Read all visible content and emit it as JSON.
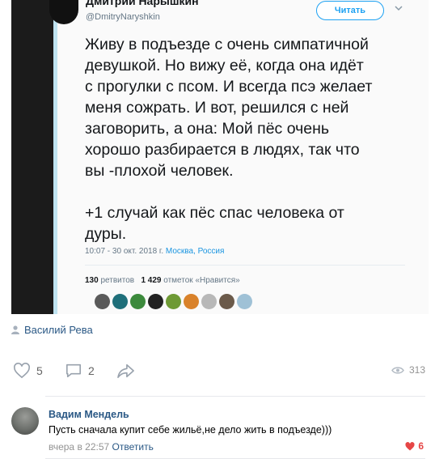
{
  "tweet": {
    "author_name": "Дмитрий Нарышкин",
    "author_handle": "@DmitryNaryshkin",
    "follow_label": "Читать",
    "text": "Живу в подъезде с очень симпатичной\nдевушкой. Но вижу её, когда она идёт\nс прогулки с псом. И всегда псэ желает\nменя сожрать. И вот, решился с ней\nзаговорить, а она: Мой пёс очень\nхорошо разбирается в людях, так что\nвы -плохой человек.\n\n+1 случай как пёс спас человека от\nдуры.",
    "timestamp": "10:07 - 30 окт. 2018 г.",
    "location": "Москва, Россия",
    "retweets_count": "130",
    "retweets_label": "ретвитов",
    "likes_count": "1 429",
    "likes_label": "отметок «Нравится»",
    "liker_colors": [
      "#5a5a5a",
      "#1f6f7a",
      "#3c8a3c",
      "#222222",
      "#6e9a35",
      "#d9822b",
      "#b8b8b8",
      "#6b5a4a",
      "#9fc1d6"
    ]
  },
  "post": {
    "author": "Василий Рева",
    "likes": "5",
    "comments": "2",
    "views": "313"
  },
  "comment": {
    "author": "Вадим Мендель",
    "text": "Пусть сначала купит себе жильё,не дело жить в подъезде)))",
    "time": "вчера в 22:57",
    "reply_label": "Ответить",
    "likes": "6"
  },
  "colors": {
    "link": "#2a5885",
    "twitter_blue": "#1da1f2",
    "like_red": "#e64646",
    "muted": "#939393"
  }
}
